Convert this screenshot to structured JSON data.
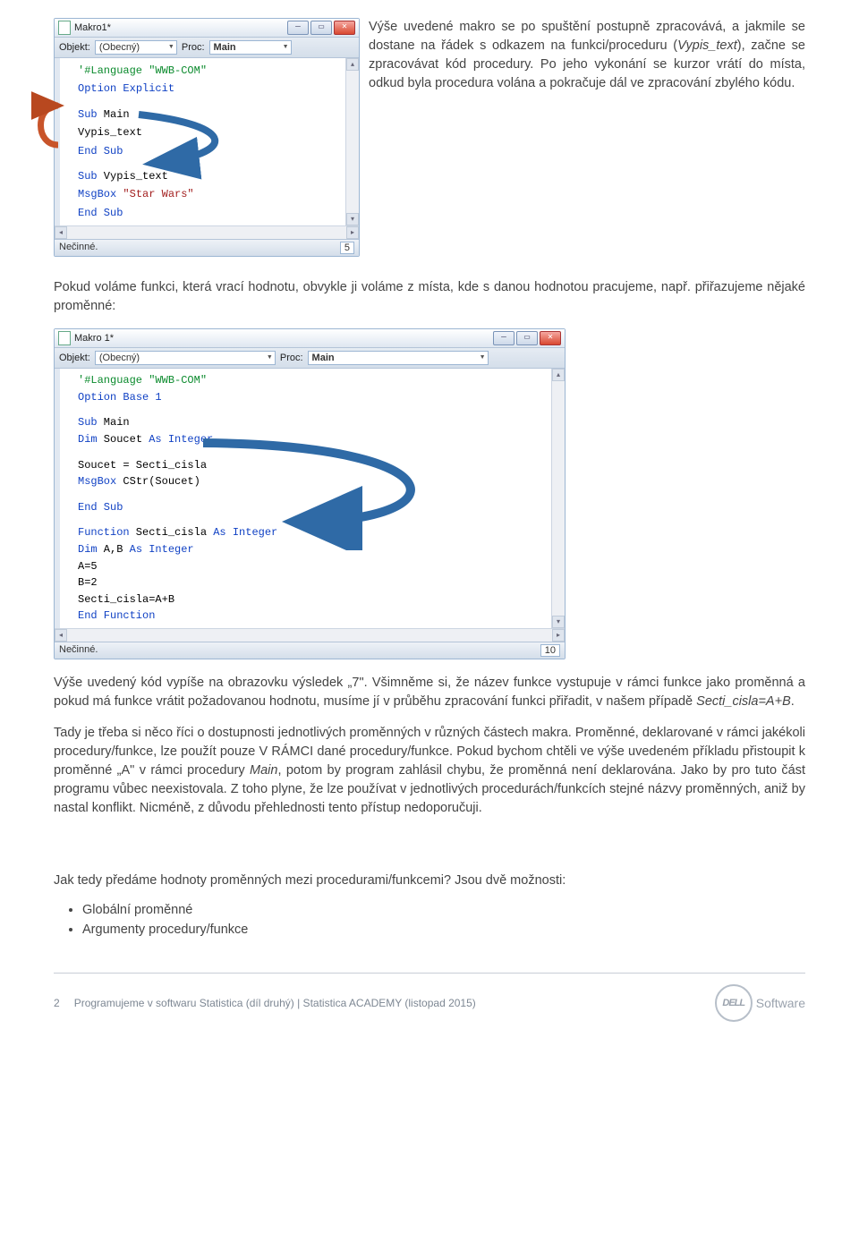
{
  "codebox1": {
    "title": "Makro1*",
    "objekt_label": "Objekt:",
    "objekt_value": "(Obecný)",
    "proc_label": "Proc:",
    "proc_value": "Main",
    "lines": {
      "l1": "'#Language \"WWB-COM\"",
      "l2a": "Option",
      "l2b": " Explicit",
      "l3a": "Sub",
      "l3b": " Main",
      "l4": "Vypis_text",
      "l5": "End Sub",
      "l6a": "Sub",
      "l6b": " Vypis_text",
      "l7a": "MsgBox ",
      "l7b": "\"Star Wars\"",
      "l8": "End Sub"
    },
    "status_left": "Nečinné.",
    "status_right": "5"
  },
  "para1": "Výše uvedené makro se po spuštění postupně zpracovává, a jakmile se dostane na řádek s odkazem na funkci/proceduru (",
  "para1_it": "Vypis_text",
  "para1b": "), začne se zpracovávat kód procedury. Po jeho vykonání se kurzor vrátí do místa, odkud byla procedura volána a pokračuje dál ve zpracování zbylého kódu.",
  "para2": "Pokud voláme funkci, která vrací hodnotu, obvykle ji voláme z místa, kde s danou hodnotou pracujeme, např. přiřazujeme nějaké proměnné:",
  "codebox2": {
    "title": "Makro 1*",
    "objekt_label": "Objekt:",
    "objekt_value": "(Obecný)",
    "proc_label": "Proc:",
    "proc_value": "Main",
    "lines": {
      "l1": "'#Language \"WWB-COM\"",
      "l2a": "Option",
      "l2b": " Base 1",
      "l3a": "Sub",
      "l3b": " Main",
      "l4a": "Dim",
      "l4b": " Soucet ",
      "l4c": "As Integer",
      "l5": "Soucet = Secti_cisla ",
      "l6a": "MsgBox",
      "l6b": " CStr(Soucet)",
      "l7": "End Sub",
      "l8a": "Function",
      "l8b": " Secti_cisla ",
      "l8c": "As Integer",
      "l9a": "Dim",
      "l9b": " A,B ",
      "l9c": "As Integer",
      "l10": "A=5",
      "l11": "B=2",
      "l12": "Secti_cisla=A+B",
      "l13": "End Function"
    },
    "status_left": "Nečinné.",
    "status_right": "10"
  },
  "para3a": "Výše uvedený kód vypíše na obrazovku výsledek „7\". Všimněme si, že název funkce vystupuje v rámci funkce jako proměnná a pokud má funkce vrátit požadovanou hodnotu, musíme jí v průběhu zpracování funkci přiřadit, v našem případě ",
  "para3_it": "Secti_cisla=A+B",
  "para3b": ".",
  "para4a": "Tady je třeba si něco říci o dostupnosti jednotlivých proměnných v různých částech makra. Proměnné, deklarované v rámci jakékoli procedury/funkce, lze použít pouze V RÁMCI dané procedury/funkce. Pokud bychom chtěli ve výše uvedeném příkladu přistoupit k proměnné „A\" v rámci procedury ",
  "para4_it": "Main",
  "para4b": ", potom by program zahlásil chybu, že proměnná není deklarována. Jako by pro tuto část programu vůbec neexistovala. Z toho plyne, že lze používat v jednotlivých procedurách/funkcích stejné názvy proměnných, aniž by nastal konflikt. Nicméně, z důvodu přehlednosti tento přístup nedoporučuji.",
  "para5": "Jak tedy předáme hodnoty proměnných mezi procedurami/funkcemi? Jsou dvě možnosti:",
  "bullet1": "Globální proměnné",
  "bullet2": "Argumenty procedury/funkce",
  "footer": {
    "page": "2",
    "left": "Programujeme v softwaru Statistica (díl druhý)  |  Statistica ACADEMY (listopad 2015)",
    "dell": "DELL",
    "soft": "Software"
  }
}
